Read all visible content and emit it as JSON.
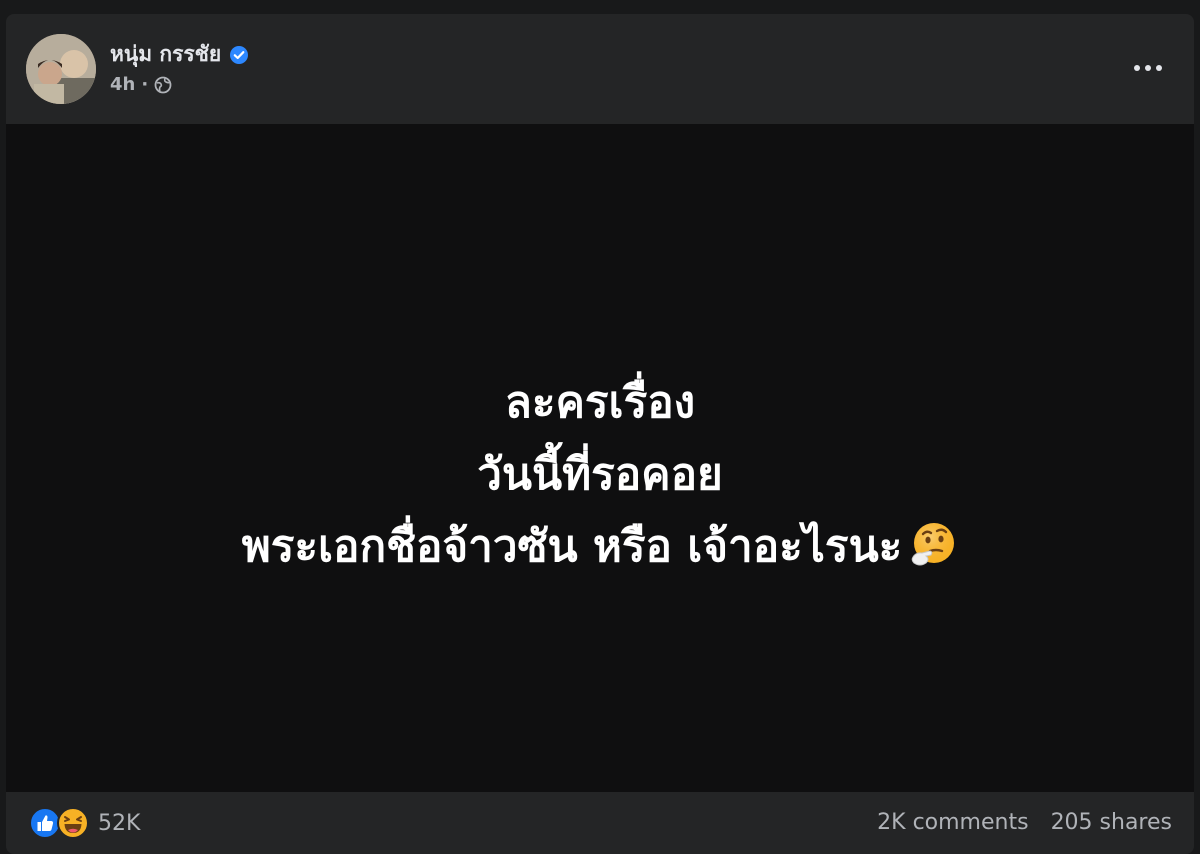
{
  "post": {
    "author": "หนุ่ม กรรชัย",
    "time": "4h",
    "separator": "·",
    "verified_icon": "verified-badge-icon",
    "privacy_icon": "globe-icon",
    "more_icon": "more-options-icon"
  },
  "media": {
    "lines": [
      "ละครเรื่อง",
      "วันนี้ที่รอคอย",
      "พระเอกชื่อจ้าวซัน หรือ เจ้าอะไรนะ"
    ],
    "emoji": "thinking-face-icon"
  },
  "footer": {
    "reaction_icons": [
      "like-reaction-icon",
      "haha-reaction-icon"
    ],
    "reaction_count": "52K",
    "comments": "2K comments",
    "shares": "205 shares"
  },
  "colors": {
    "background": "#18191a",
    "card": "#242526",
    "media": "#0f0f10",
    "verified": "#2d88ff",
    "like": "#1877f2",
    "haha": "#f7b125"
  }
}
